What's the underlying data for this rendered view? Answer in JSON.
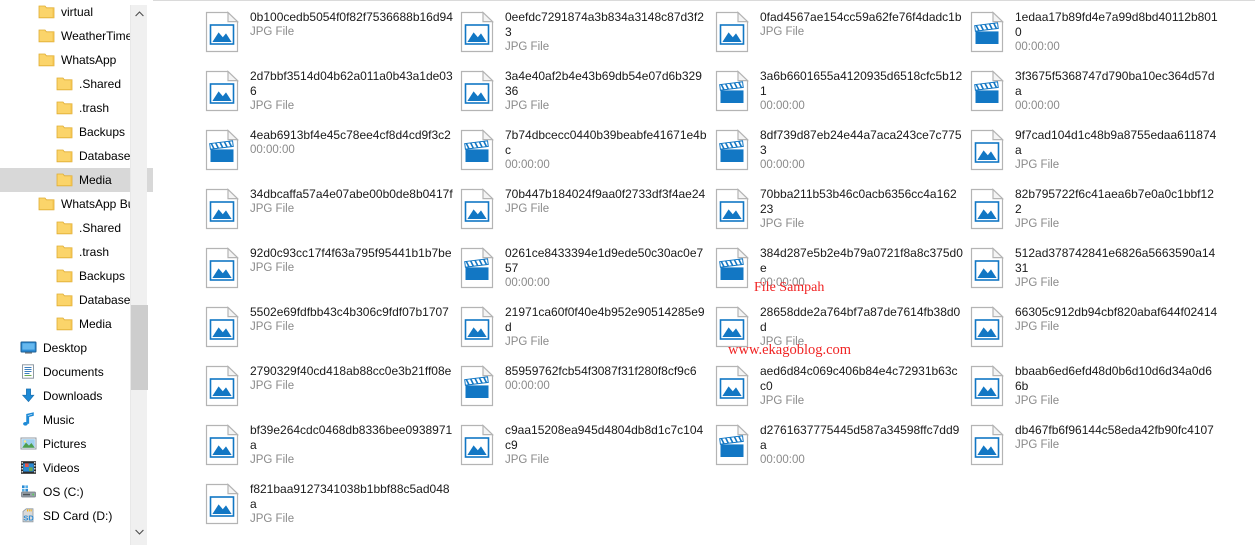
{
  "window": {
    "title": "Media",
    "accent_color": "#0078d7",
    "selection_color": "#d8d8d8",
    "watermark_color": "#f02424"
  },
  "nav_pane": {
    "scrollbar": {
      "up_arrow": "⌃",
      "down_arrow": "⌄"
    },
    "items": [
      {
        "label": "virtual",
        "icon": "folder-icon",
        "indent": 1,
        "selected": false
      },
      {
        "label": "WeatherTime",
        "icon": "folder-icon",
        "indent": 1,
        "selected": false
      },
      {
        "label": "WhatsApp",
        "icon": "folder-icon",
        "indent": 1,
        "selected": false
      },
      {
        "label": ".Shared",
        "icon": "folder-icon",
        "indent": 2,
        "selected": false
      },
      {
        "label": ".trash",
        "icon": "folder-icon",
        "indent": 2,
        "selected": false
      },
      {
        "label": "Backups",
        "icon": "folder-icon",
        "indent": 2,
        "selected": false
      },
      {
        "label": "Databases",
        "icon": "folder-icon",
        "indent": 2,
        "selected": false
      },
      {
        "label": "Media",
        "icon": "folder-icon",
        "indent": 2,
        "selected": true
      },
      {
        "label": "WhatsApp Bu",
        "icon": "folder-icon",
        "indent": 1,
        "selected": false
      },
      {
        "label": ".Shared",
        "icon": "folder-icon",
        "indent": 2,
        "selected": false
      },
      {
        "label": ".trash",
        "icon": "folder-icon",
        "indent": 2,
        "selected": false
      },
      {
        "label": "Backups",
        "icon": "folder-icon",
        "indent": 2,
        "selected": false
      },
      {
        "label": "Databases",
        "icon": "folder-icon",
        "indent": 2,
        "selected": false
      },
      {
        "label": "Media",
        "icon": "folder-icon",
        "indent": 2,
        "selected": false
      },
      {
        "label": "Desktop",
        "icon": "desktop-icon",
        "indent": 0,
        "selected": false
      },
      {
        "label": "Documents",
        "icon": "documents-icon",
        "indent": 0,
        "selected": false
      },
      {
        "label": "Downloads",
        "icon": "downloads-icon",
        "indent": 0,
        "selected": false
      },
      {
        "label": "Music",
        "icon": "music-icon",
        "indent": 0,
        "selected": false
      },
      {
        "label": "Pictures",
        "icon": "pictures-icon",
        "indent": 0,
        "selected": false
      },
      {
        "label": "Videos",
        "icon": "videos-icon",
        "indent": 0,
        "selected": false
      },
      {
        "label": "OS (C:)",
        "icon": "harddisk-icon",
        "indent": 0,
        "selected": false
      },
      {
        "label": "SD Card (D:)",
        "icon": "sdcard-icon",
        "indent": 0,
        "selected": false
      }
    ]
  },
  "file_list": {
    "view": "medium-icons",
    "columns": 4,
    "rows": 9,
    "files": [
      {
        "name": "0b100cedb5054f0f82f7536688b16d94",
        "meta": "JPG File",
        "icon": "image-file-icon"
      },
      {
        "name": "2d7bbf3514d04b62a011a0b43a1de036",
        "meta": "JPG File",
        "icon": "image-file-icon"
      },
      {
        "name": "4eab6913bf4e45c78ee4cf8d4cd9f3c2",
        "meta": "00:00:00",
        "icon": "video-file-icon"
      },
      {
        "name": "34dbcaffa57a4e07abe00b0de8b0417f",
        "meta": "JPG File",
        "icon": "image-file-icon"
      },
      {
        "name": "92d0c93cc17f4f63a795f95441b1b7be",
        "meta": "JPG File",
        "icon": "image-file-icon"
      },
      {
        "name": "5502e69fdfbb43c4b306c9fdf07b1707",
        "meta": "JPG File",
        "icon": "image-file-icon"
      },
      {
        "name": "2790329f40cd418ab88cc0e3b21ff08e",
        "meta": "JPG File",
        "icon": "image-file-icon"
      },
      {
        "name": "bf39e264cdc0468db8336bee0938971a",
        "meta": "JPG File",
        "icon": "image-file-icon"
      },
      {
        "name": "f821baa9127341038b1bbf88c5ad048a",
        "meta": "JPG File",
        "icon": "image-file-icon"
      },
      {
        "name": "0eefdc7291874a3b834a3148c87d3f23",
        "meta": "JPG File",
        "icon": "image-file-icon"
      },
      {
        "name": "3a4e40af2b4e43b69db54e07d6b32936",
        "meta": "JPG File",
        "icon": "image-file-icon"
      },
      {
        "name": "7b74dbcecc0440b39beabfe41671e4bc",
        "meta": "00:00:00",
        "icon": "video-file-icon"
      },
      {
        "name": "70b447b184024f9aa0f2733df3f4ae24",
        "meta": "JPG File",
        "icon": "image-file-icon"
      },
      {
        "name": "0261ce8433394e1d9ede50c30ac0e757",
        "meta": "00:00:00",
        "icon": "video-file-icon"
      },
      {
        "name": "21971ca60f0f40e4b952e90514285e9d",
        "meta": "JPG File",
        "icon": "image-file-icon"
      },
      {
        "name": "85959762fcb54f3087f31f280f8cf9c6",
        "meta": "00:00:00",
        "icon": "video-file-icon"
      },
      {
        "name": "c9aa15208ea945d4804db8d1c7c104c9",
        "meta": "JPG File",
        "icon": "image-file-icon"
      },
      {
        "name": "",
        "meta": "",
        "icon": ""
      },
      {
        "name": "0fad4567ae154cc59a62fe76f4dadc1b",
        "meta": "JPG File",
        "icon": "image-file-icon"
      },
      {
        "name": "3a6b6601655a4120935d6518cfc5b121",
        "meta": "00:00:00",
        "icon": "video-file-icon"
      },
      {
        "name": "8df739d87eb24e44a7aca243ce7c7753",
        "meta": "00:00:00",
        "icon": "video-file-icon"
      },
      {
        "name": "70bba211b53b46c0acb6356cc4a16223",
        "meta": "JPG File",
        "icon": "image-file-icon"
      },
      {
        "name": "384d287e5b2e4b79a0721f8a8c375d0e",
        "meta": "00:00:00",
        "icon": "video-file-icon"
      },
      {
        "name": "28658dde2a764bf7a87de7614fb38d0d",
        "meta": "JPG File",
        "icon": "image-file-icon"
      },
      {
        "name": "aed6d84c069c406b84e4c72931b63cc0",
        "meta": "JPG File",
        "icon": "image-file-icon"
      },
      {
        "name": "d2761637775445d587a34598ffc7dd9a",
        "meta": "00:00:00",
        "icon": "video-file-icon"
      },
      {
        "name": "",
        "meta": "",
        "icon": ""
      },
      {
        "name": "1edaa17b89fd4e7a99d8bd40112b8010",
        "meta": "00:00:00",
        "icon": "video-file-icon"
      },
      {
        "name": "3f3675f5368747d790ba10ec364d57da",
        "meta": "00:00:00",
        "icon": "video-file-icon"
      },
      {
        "name": "9f7cad104d1c48b9a8755edaa611874a",
        "meta": "JPG File",
        "icon": "image-file-icon"
      },
      {
        "name": "82b795722f6c41aea6b7e0a0c1bbf122",
        "meta": "JPG File",
        "icon": "image-file-icon"
      },
      {
        "name": "512ad378742841e6826a5663590a1431",
        "meta": "JPG File",
        "icon": "image-file-icon"
      },
      {
        "name": "66305c912db94cbf820abaf644f02414",
        "meta": "JPG File",
        "icon": "image-file-icon"
      },
      {
        "name": "bbaab6ed6efd48d0b6d10d6d34a0d66b",
        "meta": "JPG File",
        "icon": "image-file-icon"
      },
      {
        "name": "db467fb6f96144c58eda42fb90fc4107",
        "meta": "JPG File",
        "icon": "image-file-icon"
      },
      {
        "name": "",
        "meta": "",
        "icon": ""
      }
    ]
  },
  "watermarks": {
    "label": "File Sampah",
    "site": "www.ekagoblog.com"
  }
}
